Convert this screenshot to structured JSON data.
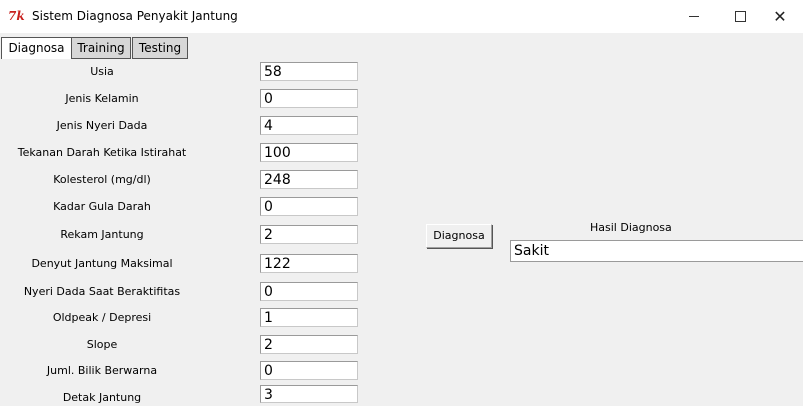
{
  "window": {
    "title": "Sistem Diagnosa Penyakit Jantung",
    "icon": "tk-icon",
    "minimize": "minimize-icon",
    "maximize": "maximize-icon",
    "close_symbol": "✕"
  },
  "tabs": [
    {
      "label": "Diagnosa",
      "active": true
    },
    {
      "label": "Training",
      "active": false
    },
    {
      "label": "Testing",
      "active": false
    }
  ],
  "form": {
    "fields": [
      {
        "label": "Usia",
        "value": "58"
      },
      {
        "label": "Jenis Kelamin",
        "value": "0"
      },
      {
        "label": "Jenis Nyeri Dada",
        "value": "4"
      },
      {
        "label": "Tekanan Darah Ketika Istirahat",
        "value": "100"
      },
      {
        "label": "Kolesterol (mg/dl)",
        "value": "248"
      },
      {
        "label": "Kadar Gula Darah",
        "value": "0"
      },
      {
        "label": "Rekam Jantung",
        "value": "2"
      },
      {
        "label": "Denyut Jantung Maksimal",
        "value": "122"
      },
      {
        "label": "Nyeri Dada Saat Beraktifitas",
        "value": "0"
      },
      {
        "label": "Oldpeak / Depresi",
        "value": "1"
      },
      {
        "label": "Slope",
        "value": "2"
      },
      {
        "label": "Juml. Bilik Berwarna",
        "value": "0"
      },
      {
        "label": "Detak Jantung",
        "value": "3"
      }
    ]
  },
  "actions": {
    "diagnosa_label": "Diagnosa"
  },
  "result": {
    "label": "Hasil Diagnosa",
    "value": "Sakit"
  }
}
